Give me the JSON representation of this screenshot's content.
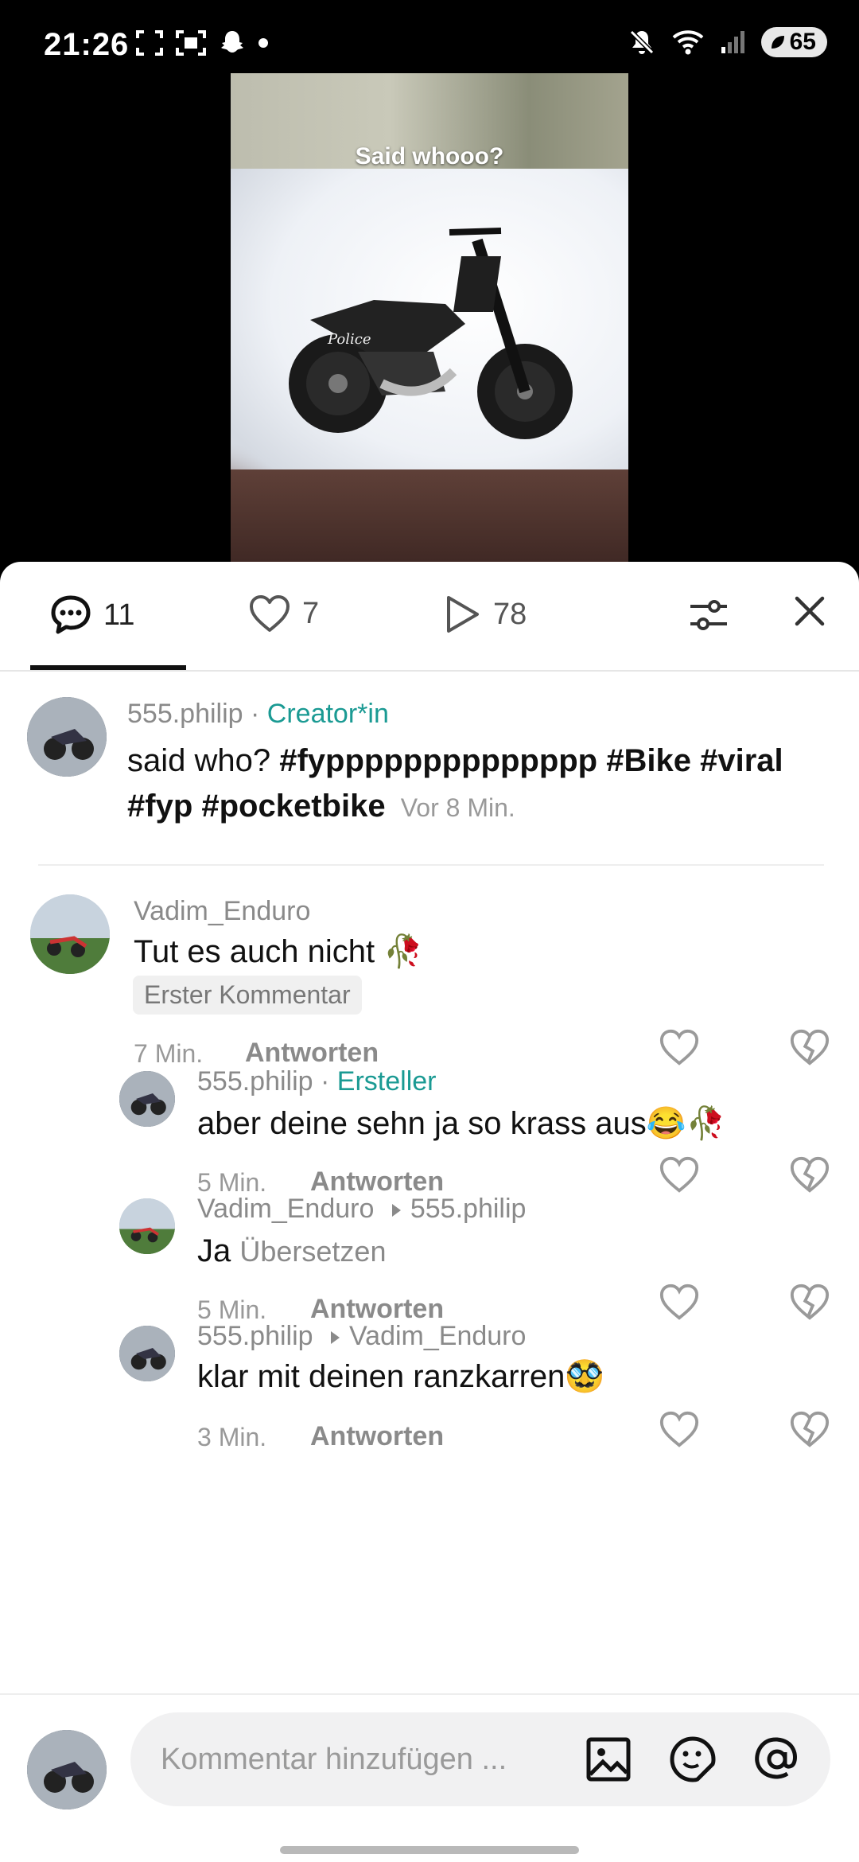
{
  "status_bar": {
    "time": "21:26",
    "battery": "65"
  },
  "video": {
    "caption": "Said whooo?",
    "bike_label": "Police"
  },
  "tabs": {
    "comments_count": "11",
    "likes_count": "7",
    "views_count": "78"
  },
  "caption_post": {
    "author": "555.philip",
    "separator": " · ",
    "role": "Creator*in",
    "text_plain": "said who? ",
    "hashtags_line1": "#fypppppppppppppp #Bike #viral",
    "hashtags_line2": "#fyp #pocketbike",
    "time": "Vor 8 Min."
  },
  "comments": [
    {
      "author": "Vadim_Enduro",
      "text": "Tut es auch nicht 🥀",
      "badge": "Erster Kommentar",
      "time": "7 Min.",
      "reply_label": "Antworten"
    },
    {
      "author": "555.philip",
      "separator": " · ",
      "role": "Ersteller",
      "text": "aber deine sehn ja so krass aus😂🥀",
      "time": "5 Min.",
      "reply_label": "Antworten"
    },
    {
      "author": "Vadim_Enduro",
      "reply_to": "555.philip",
      "text": "Ja",
      "translate": "Übersetzen",
      "time": "5 Min.",
      "reply_label": "Antworten"
    },
    {
      "author": "555.philip",
      "reply_to": "Vadim_Enduro",
      "text": "klar mit deinen ranzkarren🥸",
      "time": "3 Min.",
      "reply_label": "Antworten"
    }
  ],
  "input": {
    "placeholder": "Kommentar hinzufügen ..."
  },
  "icons": [
    "comment-icon",
    "heart-icon",
    "play-icon",
    "filter-icon",
    "close-icon",
    "image-icon",
    "sticker-icon",
    "mention-icon",
    "dislike-icon"
  ]
}
